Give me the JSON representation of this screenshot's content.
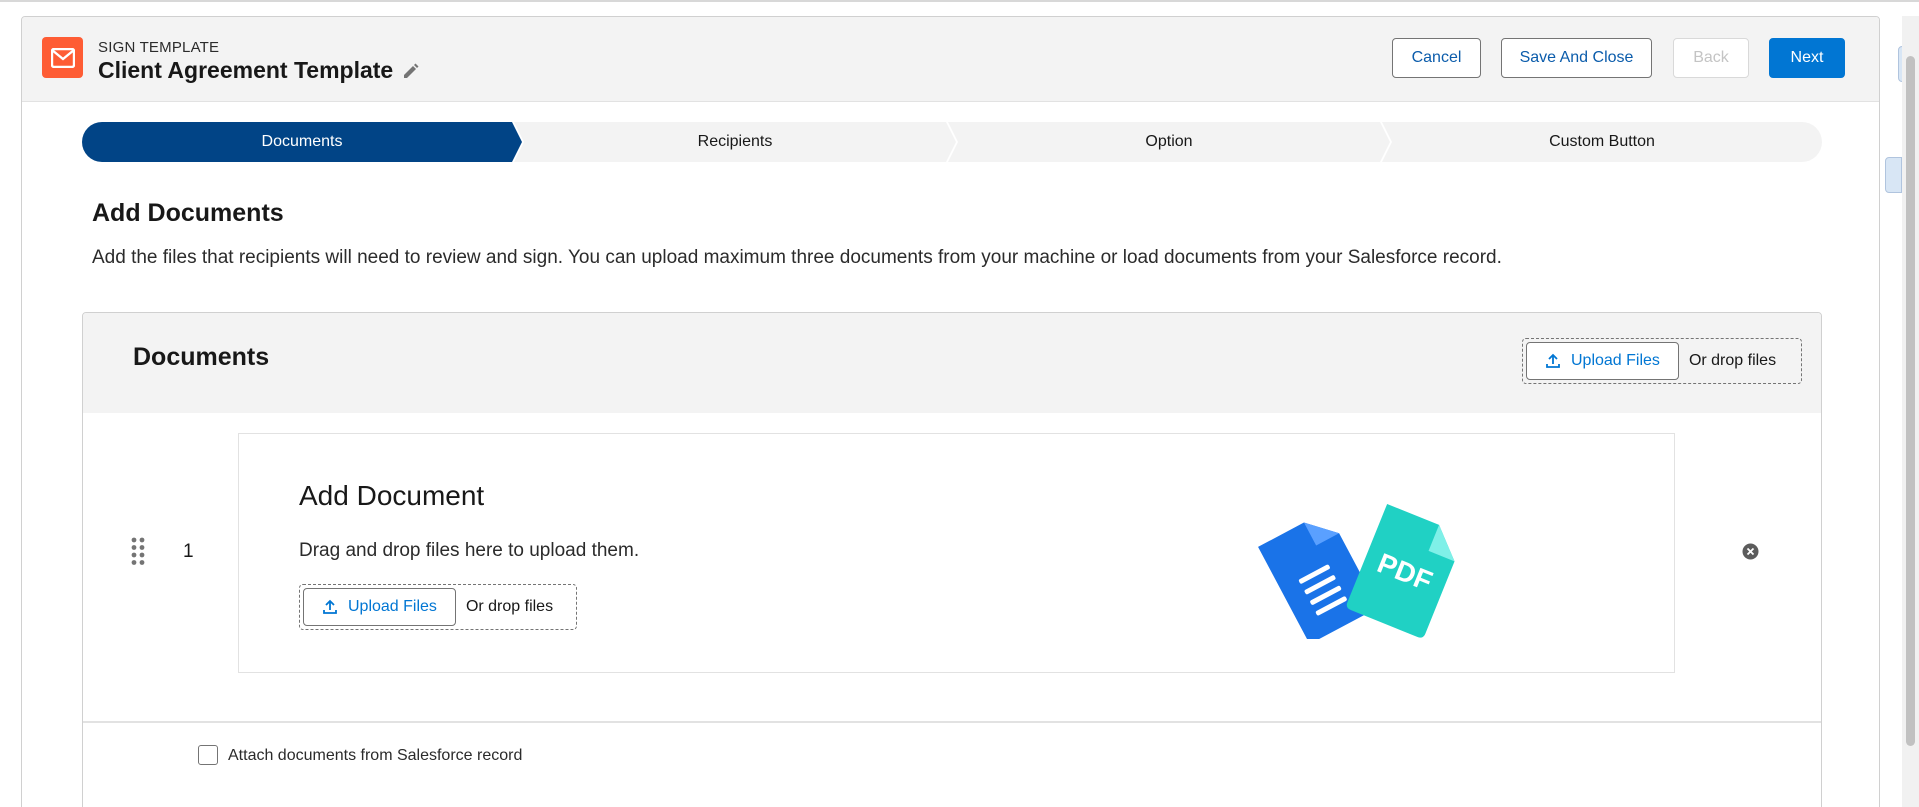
{
  "header": {
    "eyebrow": "SIGN TEMPLATE",
    "title": "Client Agreement Template",
    "buttons": {
      "cancel": "Cancel",
      "save_and_close": "Save And Close",
      "back": "Back",
      "next": "Next"
    }
  },
  "path": {
    "steps": [
      "Documents",
      "Recipients",
      "Option",
      "Custom Button"
    ],
    "active_index": 0
  },
  "section": {
    "title": "Add Documents",
    "description": "Add the files that recipients will need to review and sign. You can upload maximum three documents from your machine or load documents from your Salesforce record."
  },
  "documents": {
    "title": "Documents",
    "upload_label": "Upload Files",
    "drop_label": "Or drop files",
    "rows": [
      {
        "number": "1",
        "card_title": "Add Document",
        "card_desc": "Drag and drop files here to upload them.",
        "upload_label": "Upload Files",
        "drop_label": "Or drop files",
        "illustration_text": "PDF"
      }
    ],
    "attach_label": "Attach documents from Salesforce record"
  },
  "colors": {
    "brand_orange": "#fe5c34",
    "active_step": "#014486",
    "primary_button": "#0176d3",
    "link_blue": "#0176d3",
    "illustration_blue": "#1a73e8",
    "illustration_teal": "#20d1c4"
  },
  "icons": [
    "mail-icon",
    "pencil-icon",
    "upload-icon",
    "drag-handle-icon",
    "close-circle-icon"
  ]
}
